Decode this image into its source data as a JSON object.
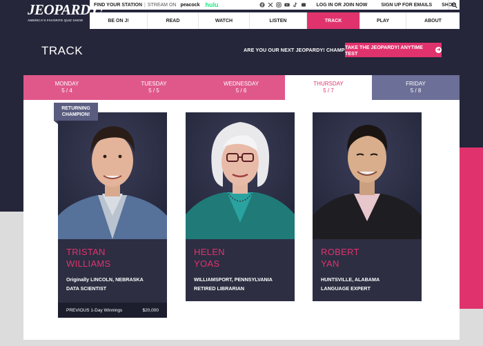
{
  "brand": {
    "logo": "JEOPARDY!",
    "tagline": "AMERICA'S FAVORITE QUIZ SHOW"
  },
  "topbar": {
    "find_station": "FIND YOUR STATION",
    "separator": "|",
    "stream_on": "STREAM ON",
    "peacock": "peacock",
    "hulu": "hulu",
    "login": "LOG IN  OR  JOIN NOW",
    "signup": "SIGN UP FOR EMAILS",
    "shop": "SHOP"
  },
  "nav": {
    "items": [
      {
        "label": "BE ON J!"
      },
      {
        "label": "READ"
      },
      {
        "label": "WATCH"
      },
      {
        "label": "LISTEN"
      },
      {
        "label": "TRACK"
      },
      {
        "label": "PLAY"
      },
      {
        "label": "ABOUT"
      }
    ],
    "active": "TRACK"
  },
  "header": {
    "title": "TRACK",
    "promo_text": "ARE YOU OUR NEXT JEOPARDY! CHAMPION?",
    "promo_button": "TAKE THE JEOPARDY! ANYTIME TEST"
  },
  "days": [
    {
      "day": "MONDAY",
      "date": "5 / 4"
    },
    {
      "day": "TUESDAY",
      "date": "5 / 5"
    },
    {
      "day": "WEDNESDAY",
      "date": "5 / 6"
    },
    {
      "day": "THURSDAY",
      "date": "5 / 7"
    },
    {
      "day": "FRIDAY",
      "date": "5 / 8"
    }
  ],
  "badge": {
    "line1": "RETURNING",
    "line2": "CHAMPION!"
  },
  "contestants": [
    {
      "first": "TRISTAN",
      "last": "WILLIAMS",
      "location": "Originally LINCOLN, NEBRASKA",
      "occupation": "DATA SCIENTIST",
      "winnings_label": "PREVIOUS 1-Day Winnings",
      "winnings_value": "$20,000"
    },
    {
      "first": "HELEN",
      "last": "YOAS",
      "location": "WILLIAMSPORT, PENNSYLVANIA",
      "occupation": "RETIRED LIBRARIAN"
    },
    {
      "first": "ROBERT",
      "last": "YAN",
      "location": "HUNTSVILLE, ALABAMA",
      "occupation": "LANGUAGE EXPERT"
    }
  ],
  "colors": {
    "accent": "#e0336e",
    "dark": "#25263a",
    "card": "#2d2e42",
    "friday_tab": "#6c6f97"
  }
}
